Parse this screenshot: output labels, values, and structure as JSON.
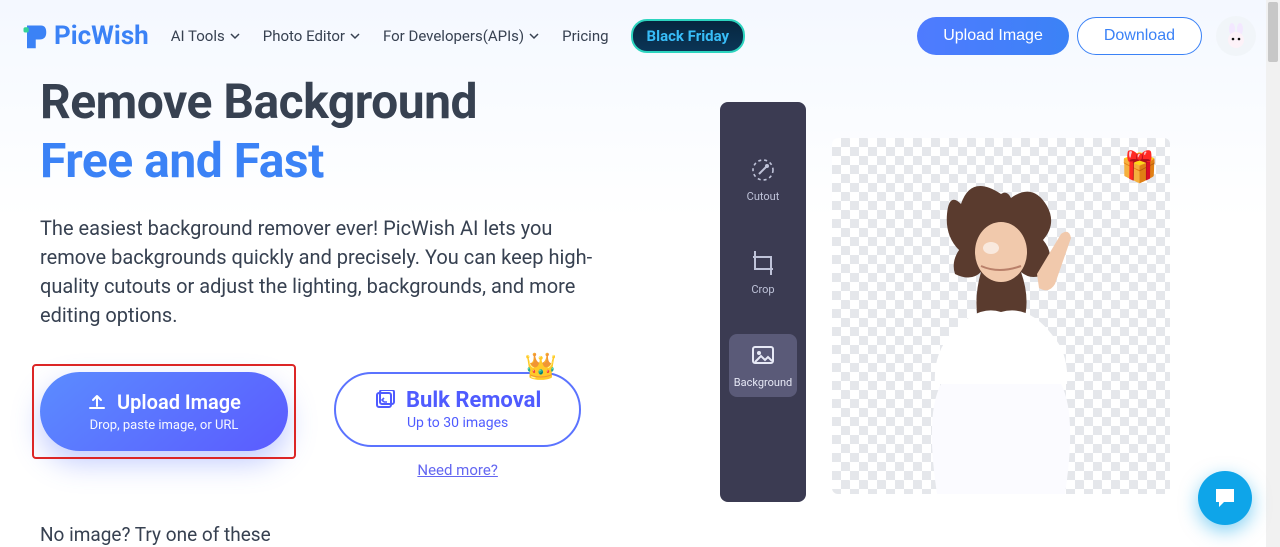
{
  "brand": {
    "name": "PicWish"
  },
  "nav": {
    "items": [
      {
        "label": "AI Tools"
      },
      {
        "label": "Photo Editor"
      },
      {
        "label": "For Developers(APIs)"
      },
      {
        "label": "Pricing"
      }
    ],
    "promo": "Black Friday"
  },
  "header_actions": {
    "upload": "Upload Image",
    "download": "Download"
  },
  "hero": {
    "title_line1": "Remove Background",
    "title_line2": "Free and Fast",
    "description": "The easiest background remover ever! PicWish AI lets you remove backgrounds quickly and precisely. You can keep high-quality cutouts or adjust the lighting, backgrounds, and more editing options."
  },
  "upload_cta": {
    "label": "Upload Image",
    "sub": "Drop, paste image, or URL"
  },
  "bulk_cta": {
    "label": "Bulk Removal",
    "sub": "Up to 30 images",
    "need_more": "Need more?"
  },
  "no_image_hint": "No image? Try one of these",
  "toolstrip": {
    "cutout": "Cutout",
    "crop": "Crop",
    "background": "Background"
  },
  "colors": {
    "accent": "#3b82f6",
    "highlight": "#dc2626"
  }
}
